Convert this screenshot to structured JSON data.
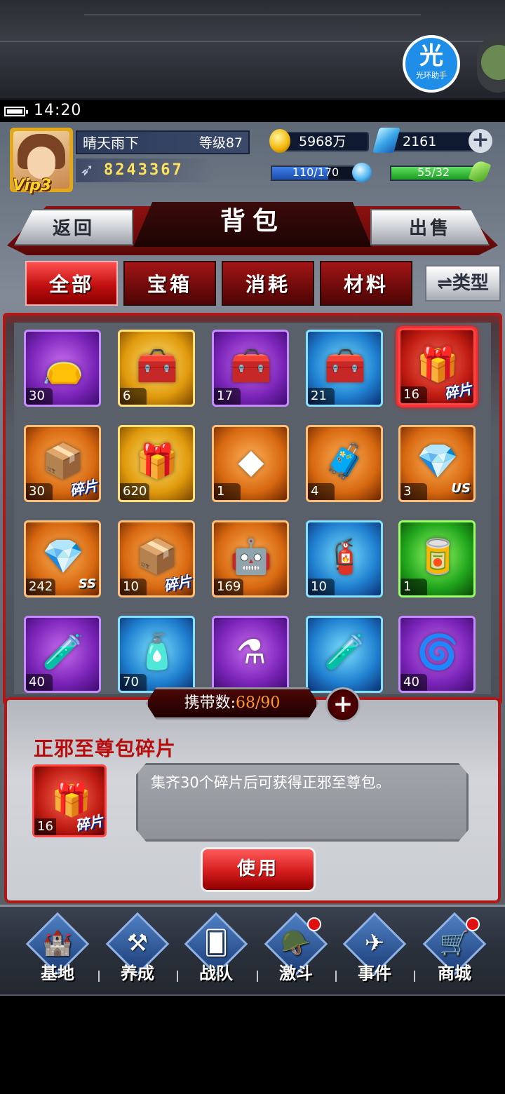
{
  "helper": {
    "big": "光",
    "small": "光环助手"
  },
  "status": {
    "time": "14:20"
  },
  "player": {
    "name": "晴天雨下",
    "level": "等级87",
    "vip": "Vip3",
    "power": "8243367"
  },
  "resources": {
    "gold": "5968万",
    "gems": "2161",
    "energy": "110/170",
    "energy_fraction": 0.647,
    "stamina": "55/32"
  },
  "header": {
    "title": "背包",
    "back_label": "返回",
    "sell_label": "出售"
  },
  "tabs": [
    {
      "label": "全部",
      "active": true
    },
    {
      "label": "宝箱",
      "active": false
    },
    {
      "label": "消耗",
      "active": false
    },
    {
      "label": "材料",
      "active": false
    }
  ],
  "type_label": "⇌类型",
  "fragment_tag": "碎片",
  "items": [
    {
      "count": "30"
    },
    {
      "count": "6"
    },
    {
      "count": "17"
    },
    {
      "count": "21"
    },
    {
      "count": "16"
    },
    {
      "count": "30"
    },
    {
      "count": "620"
    },
    {
      "count": "1"
    },
    {
      "count": "4"
    },
    {
      "count": "3",
      "grade": "US"
    },
    {
      "count": "242",
      "grade": "SS"
    },
    {
      "count": "10"
    },
    {
      "count": "169"
    },
    {
      "count": "10"
    },
    {
      "count": "1"
    },
    {
      "count": "40"
    },
    {
      "count": "70"
    },
    {
      "count": ""
    },
    {
      "count": ""
    },
    {
      "count": "40"
    }
  ],
  "capacity": {
    "label": "携带数:",
    "value": "68/90"
  },
  "detail": {
    "name": "正邪至尊包碎片",
    "count": "16",
    "description": "集齐30个碎片后可获得正邪至尊包。",
    "use_label": "使用"
  },
  "nav": [
    {
      "label": "基地",
      "icon": "base-icon",
      "badge": false
    },
    {
      "label": "养成",
      "icon": "train-icon",
      "badge": false
    },
    {
      "label": "战队",
      "icon": "team-icon",
      "badge": false
    },
    {
      "label": "激斗",
      "icon": "battle-icon",
      "badge": true
    },
    {
      "label": "事件",
      "icon": "event-icon",
      "badge": false
    },
    {
      "label": "商城",
      "icon": "shop-icon",
      "badge": true
    }
  ]
}
